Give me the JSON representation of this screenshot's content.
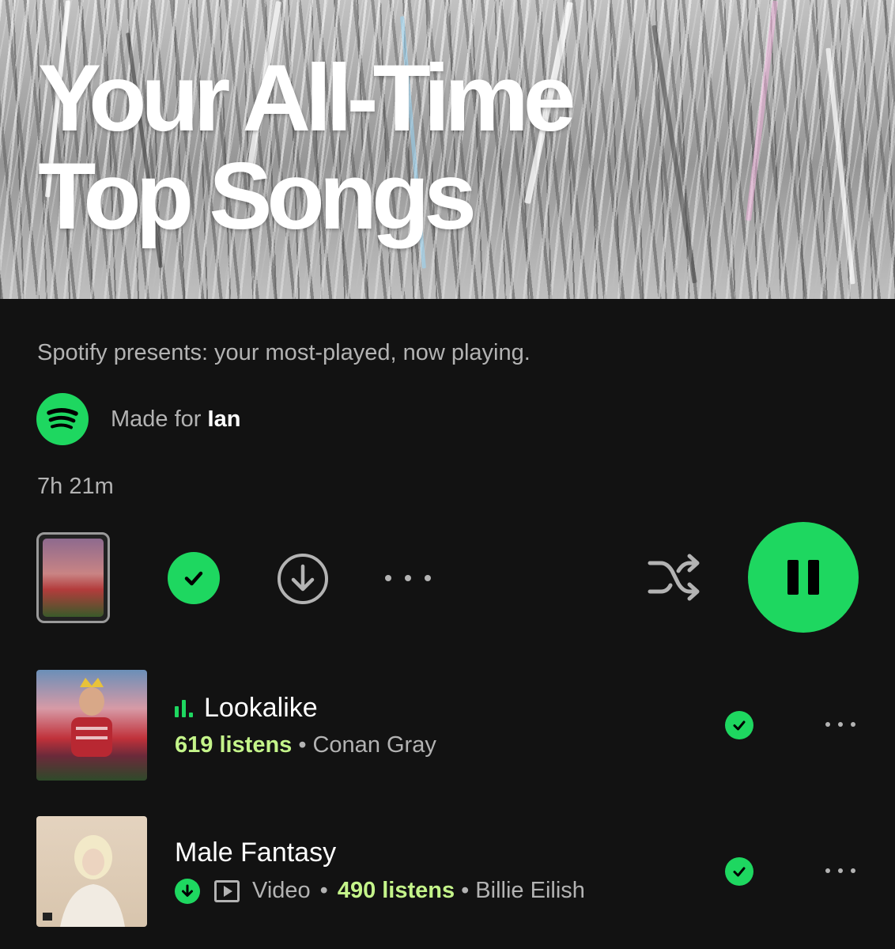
{
  "playlist": {
    "title_line1": "Your All-Time",
    "title_line2": "Top Songs",
    "description": "Spotify presents: your most-played, now playing.",
    "made_for_prefix": "Made for",
    "made_for_user": "Ian",
    "duration": "7h 21m"
  },
  "colors": {
    "accent": "#1ed760",
    "listens": "#c4f48a",
    "background": "#121212",
    "secondary_text": "#b3b3b3"
  },
  "icons": {
    "logo": "spotify-logo-icon",
    "saved": "check-circle-icon",
    "download": "download-circle-icon",
    "more": "more-horizontal-icon",
    "shuffle": "shuffle-icon",
    "pause": "pause-icon",
    "equalizer": "equalizer-icon",
    "video": "video-icon"
  },
  "tracks": [
    {
      "title": "Lookalike",
      "listens": "619 listens",
      "separator": "•",
      "artist": "Conan Gray",
      "now_playing": true
    },
    {
      "title": "Male Fantasy",
      "video_label": "Video",
      "separator": "•",
      "listens": "490 listens",
      "artist": "Billie Eilish",
      "downloaded": true
    }
  ]
}
